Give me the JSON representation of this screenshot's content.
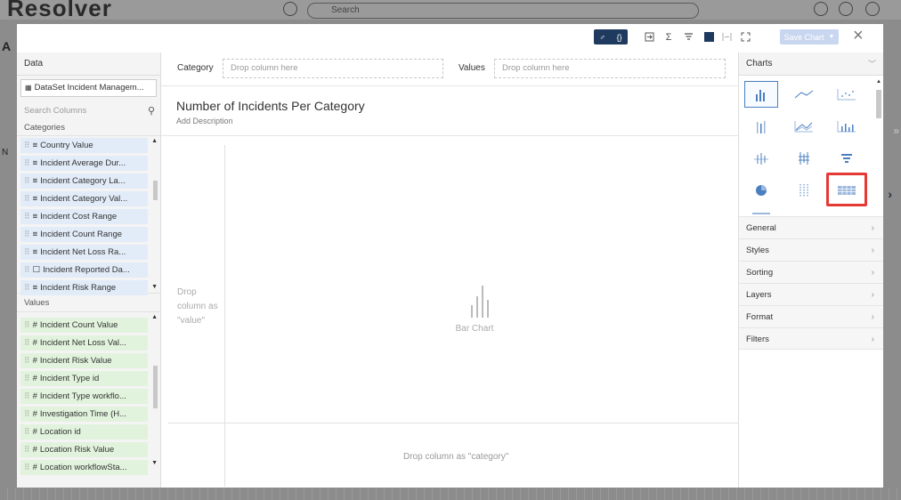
{
  "background": {
    "logo_text": "Resolver",
    "search_placeholder": "Search",
    "letter_a": "A",
    "letter_n": "N"
  },
  "toolbar": {
    "pill_left": "♂",
    "pill_right": "{}",
    "sigma": "Σ",
    "save_chart_label": "Save Chart",
    "close_symbol": "×"
  },
  "data_panel": {
    "title": "Data",
    "dataset_label": "DataSet Incident Managem...",
    "search_placeholder": "Search Columns",
    "categories_title": "Categories",
    "categories": [
      "Country Value",
      "Incident Average Dur...",
      "Incident Category La...",
      "Incident Category Val...",
      "Incident Cost Range",
      "Incident Count Range",
      "Incident Net Loss Ra...",
      "Incident Reported Da...",
      "Incident Risk Range"
    ],
    "values_title": "Values",
    "values": [
      "Incident Count Value",
      "Incident Net Loss Val...",
      "Incident Risk Value",
      "Incident Type id",
      "Incident Type workflo...",
      "Investigation Time (H...",
      "Location id",
      "Location Risk Value",
      "Location workflowSta..."
    ]
  },
  "center": {
    "category_label": "Category",
    "category_drop": "Drop column here",
    "values_label": "Values",
    "values_drop": "Drop column here",
    "chart_title": "Number of Incidents Per Category",
    "chart_description": "Add Description",
    "drop_value_text": "Drop column as \"value\"",
    "placeholder_label": "Bar Chart",
    "drop_category_text": "Drop column as \"category\""
  },
  "right_panel": {
    "charts_title": "Charts",
    "chart_types": [
      "bar-chart-icon",
      "line-chart-icon",
      "scatter-chart-icon",
      "stacked-bar-icon",
      "area-chart-icon",
      "column-chart-icon",
      "box-plot-icon",
      "range-bar-icon",
      "funnel-chart-icon",
      "pie-chart-icon",
      "dot-plot-icon",
      "table-chart-icon"
    ],
    "menu": [
      "General",
      "Styles",
      "Sorting",
      "Layers",
      "Format",
      "Filters"
    ]
  },
  "colors": {
    "accent": "#4a7fc1",
    "highlight": "#e53935",
    "category_bg": "#e2ecf8",
    "value_bg": "#e2f3dd",
    "toolbar_dark": "#1e3a5f"
  }
}
